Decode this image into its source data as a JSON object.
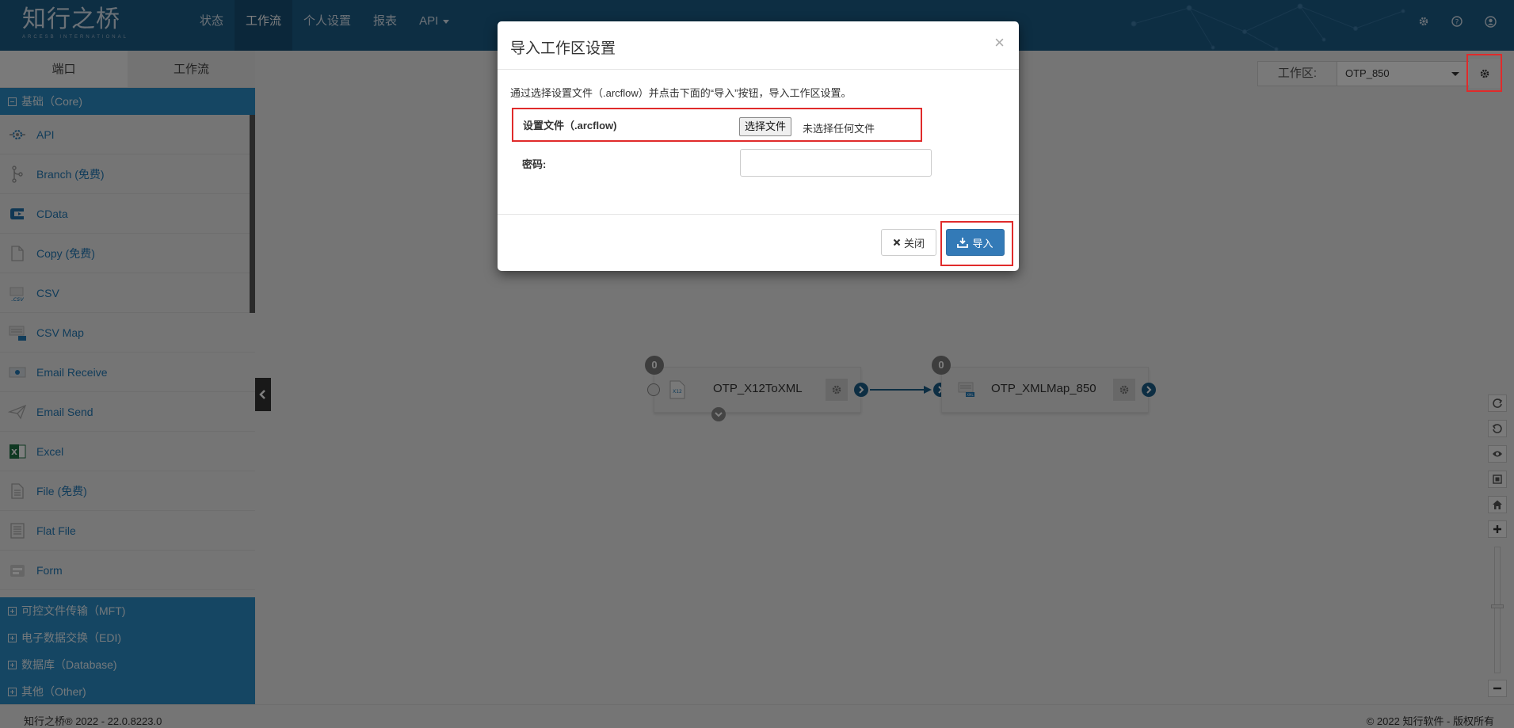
{
  "header": {
    "logo_cn": "知行之桥",
    "logo_en": "ARCESB INTERNATIONAL",
    "nav": [
      {
        "label": "状态",
        "active": false
      },
      {
        "label": "工作流",
        "active": true
      },
      {
        "label": "个人设置",
        "active": false
      },
      {
        "label": "报表",
        "active": false
      },
      {
        "label": "API",
        "active": false,
        "dropdown": true
      }
    ],
    "icons": [
      "gear-icon",
      "help-icon",
      "user-icon"
    ]
  },
  "sidebar": {
    "tabs": [
      {
        "label": "端口",
        "active": true
      },
      {
        "label": "工作流",
        "active": false
      }
    ],
    "open_category": "基础（Core)",
    "components": [
      {
        "label": "API",
        "icon": "api-icon"
      },
      {
        "label": "Branch (免费)",
        "icon": "branch-icon"
      },
      {
        "label": "CData",
        "icon": "cdata-icon"
      },
      {
        "label": "Copy (免费)",
        "icon": "copy-icon"
      },
      {
        "label": "CSV",
        "icon": "csv-icon"
      },
      {
        "label": "CSV Map",
        "icon": "csv-map-icon"
      },
      {
        "label": "Email Receive",
        "icon": "email-receive-icon"
      },
      {
        "label": "Email Send",
        "icon": "email-send-icon"
      },
      {
        "label": "Excel",
        "icon": "excel-icon"
      },
      {
        "label": "File (免费)",
        "icon": "file-icon"
      },
      {
        "label": "Flat File",
        "icon": "flat-file-icon"
      },
      {
        "label": "Form",
        "icon": "form-icon"
      }
    ],
    "collapsed_categories": [
      "可控文件传输（MFT)",
      "电子数据交换（EDI)",
      "数据库（Database)",
      "其他（Other)"
    ]
  },
  "workspace": {
    "label": "工作区:",
    "selected": "OTP_850"
  },
  "flow": {
    "nodes": [
      {
        "label": "OTP_X12ToXML",
        "count": "0",
        "icon_text": "X12"
      },
      {
        "label": "OTP_XMLMap_850",
        "count": "0",
        "icon_text": "XML"
      }
    ]
  },
  "modal": {
    "title": "导入工作区设置",
    "close_symbol": "×",
    "description": "通过选择设置文件（.arcflow）并点击下面的“导入”按钮，导入工作区设置。",
    "file_label": "设置文件（.arcflow)",
    "file_button": "选择文件",
    "file_status": "未选择任何文件",
    "password_label": "密码:",
    "btn_close": "关闭",
    "btn_import": "导入"
  },
  "footer": {
    "left": "知行之桥® 2022 - 22.0.8223.0",
    "right": "© 2022 知行软件 - 版权所有"
  },
  "colors": {
    "navbar": "#1b5c87",
    "category": "#2a8cc6",
    "primary_button": "#337ab7",
    "highlight": "#e02b2b"
  }
}
